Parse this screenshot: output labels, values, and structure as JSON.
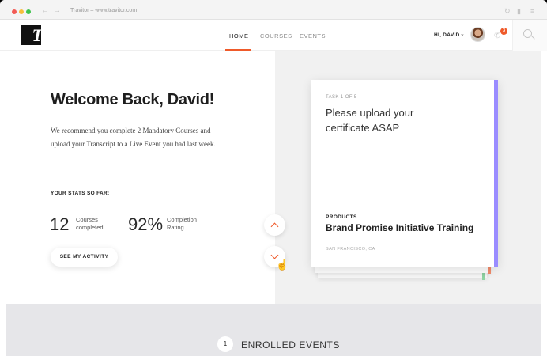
{
  "browser": {
    "address": "Travitor – www.travitor.com"
  },
  "header": {
    "logo_text": "T",
    "nav": [
      {
        "label": "HOME",
        "active": true
      },
      {
        "label": "COURSES",
        "active": false
      },
      {
        "label": "EVENTS",
        "active": false
      }
    ],
    "greeting": "HI, DAVID",
    "notification_count": "3",
    "accent_color": "#ef5a2a"
  },
  "hero": {
    "title": "Welcome Back, David!",
    "intro": "We recommend you complete 2 Mandatory Courses and upload your Transcript to a Live Event you had last week.",
    "stats_label": "YOUR STATS SO FAR:",
    "stats": [
      {
        "value": "12",
        "label": "Courses completed"
      },
      {
        "value": "92%",
        "label": "Completion Rating"
      }
    ],
    "activity_button": "SEE MY ACTIVITY"
  },
  "task_card": {
    "counter": "TASK 1 OF 5",
    "text": "Please upload your certificate ASAP",
    "category": "PRODUCTS",
    "title": "Brand Promise Initiative Training",
    "location": "SAN FRANCISCO, CA",
    "accent_color": "#9a8cff"
  },
  "enrolled": {
    "number": "1",
    "title": "ENROLLED EVENTS"
  },
  "icons": {
    "prev": "chevron-up-icon",
    "next": "chevron-down-icon",
    "search": "search-icon",
    "bell": "bell-icon"
  }
}
